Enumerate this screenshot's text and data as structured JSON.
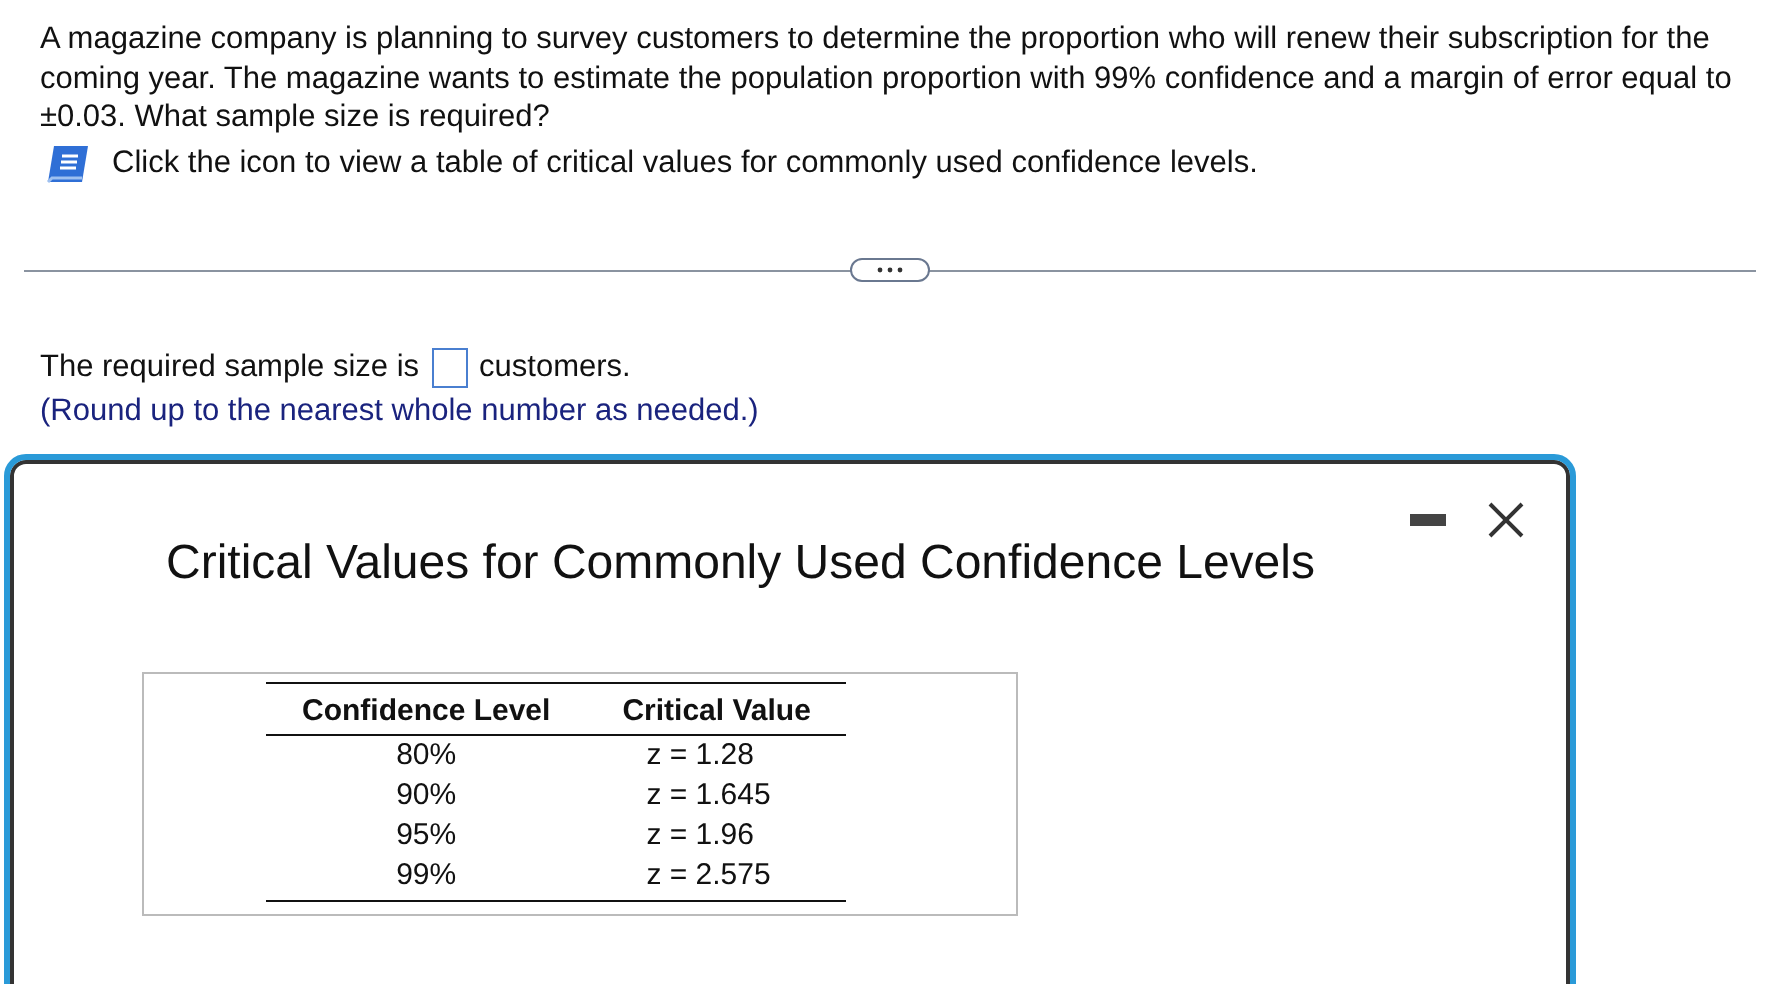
{
  "question": {
    "text": "A magazine company is planning to survey customers to determine the proportion who will renew their subscription for the coming year. The magazine wants to estimate the population proportion with 99% confidence and a margin of error equal to  ±0.03. What sample size is required?"
  },
  "hint": {
    "text": "Click the icon to view a table of critical values for commonly used confidence levels."
  },
  "answer": {
    "before": "The required sample size is",
    "after": "customers.",
    "note": "(Round up to the nearest whole number as needed.)"
  },
  "dialog": {
    "title": "Critical Values for Commonly Used Confidence Levels",
    "table": {
      "columns": [
        "Confidence Level",
        "Critical Value"
      ],
      "rows": [
        [
          "80%",
          "z = 1.28"
        ],
        [
          "90%",
          "z = 1.645"
        ],
        [
          "95%",
          "z = 1.96"
        ],
        [
          "99%",
          "z = 2.575"
        ]
      ]
    }
  }
}
